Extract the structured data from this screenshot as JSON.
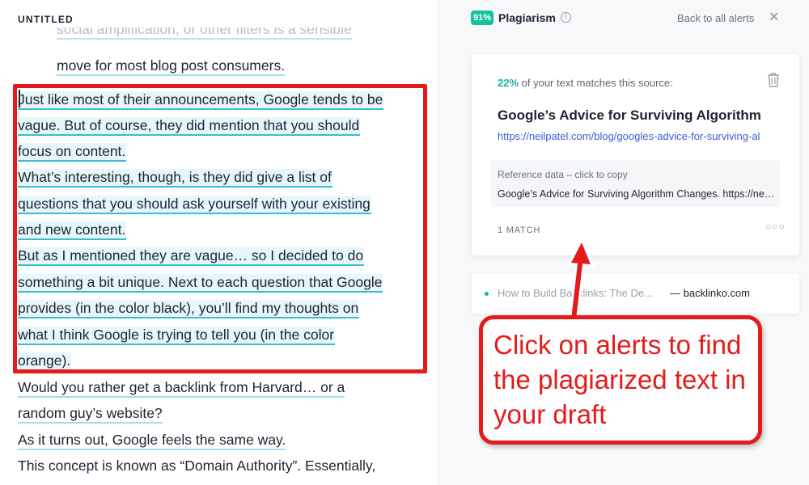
{
  "editor": {
    "doc_title": "UNTITLED",
    "lines": [
      "social amplification, or other filters is a sensible",
      "move for most blog post consumers.",
      "Just like most of their announcements, Google tends to be",
      "vague. But of course, they did mention that you should",
      "focus on content.",
      "What’s interesting, though, is they did give a list of",
      "questions that you should ask yourself with your existing",
      "and new content.",
      "But as I mentioned they are vague… so I decided to do",
      "something a bit unique. Next to each question that Google",
      "provides (in the color black), you’ll find my thoughts on",
      "what I think Google is trying to tell you (in the color",
      "orange).",
      "Would you rather get a backlink from Harvard… or a",
      "random guy’s website?",
      "As it turns out, Google feels the same way.",
      "This concept is known as “Domain Authority”. Essentially,"
    ]
  },
  "panel": {
    "score": "91%",
    "title": "Plagiarism",
    "back_label": "Back to all alerts",
    "card": {
      "match_percent": "22%",
      "match_suffix": " of your text matches this source:",
      "source_title": "Google’s Advice for Surviving Algorithm Changes",
      "source_url": "https://neilpatel.com/blog/googles-advice-for-surviving-algorithm-changes/",
      "ref_label": "Reference data – click to copy",
      "ref_value": "Google’s Advice for Surviving Algorithm Changes. https://neilpatel.com/blog/googles-advice-for-surviving-algorithm-changes/",
      "match_count": "1 MATCH"
    },
    "alert": {
      "title": "How to Build Backlinks: The De...",
      "source": "— backlinko.com"
    }
  },
  "annotation": {
    "text": "Click on alerts to find the plagiarized text in your draft"
  },
  "colors": {
    "accent_green": "#15c39a",
    "highlight_underline": "#36bed0",
    "annotation_red": "#e31b1b",
    "link_blue": "#3b5dd6"
  }
}
